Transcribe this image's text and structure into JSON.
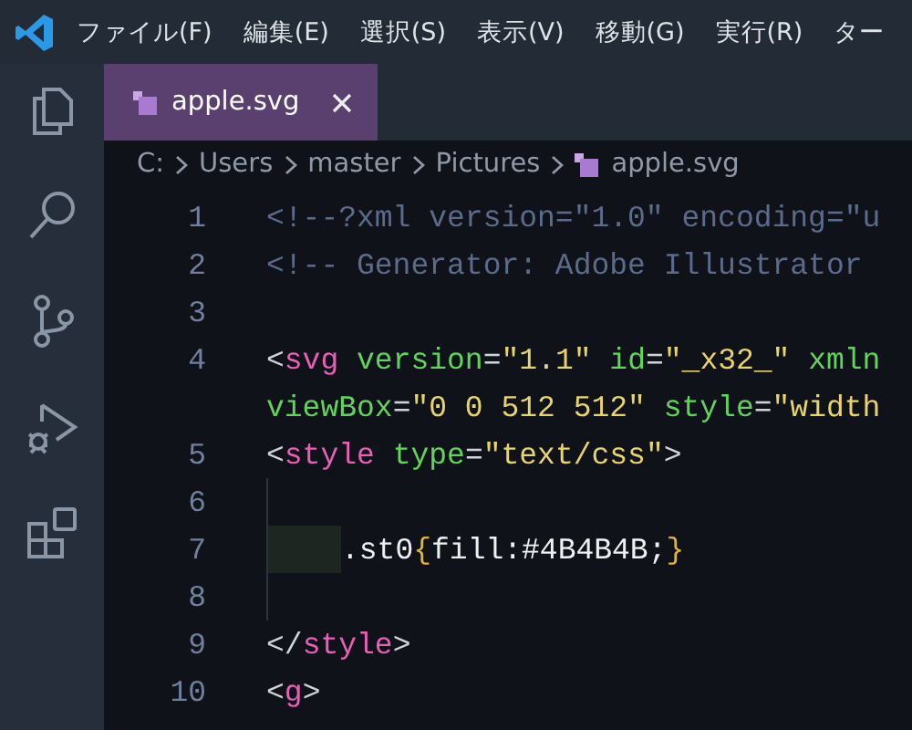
{
  "menu_bar": {
    "items": [
      "ファイル(F)",
      "編集(E)",
      "選択(S)",
      "表示(V)",
      "移動(G)",
      "実行(R)",
      "ター"
    ]
  },
  "activity_bar": {
    "items": [
      {
        "kind": "explorer",
        "selected": false
      },
      {
        "kind": "search",
        "selected": false
      },
      {
        "kind": "source-control",
        "selected": false
      },
      {
        "kind": "run",
        "selected": false
      },
      {
        "kind": "extensions",
        "selected": false
      }
    ]
  },
  "tabs": [
    {
      "label": "apple.svg",
      "selected": true
    }
  ],
  "breadcrumb": [
    {
      "label": "C:",
      "kind": "folder"
    },
    {
      "label": "Users",
      "kind": "folder"
    },
    {
      "label": "master",
      "kind": "folder"
    },
    {
      "label": "Pictures",
      "kind": "folder"
    },
    {
      "label": "apple.svg",
      "kind": "file"
    }
  ],
  "editor": {
    "lines": [
      {
        "number": "1",
        "tokens": [
          {
            "kind": "comment",
            "text": "<!--?xml version=\"1.0\" encoding=\"u"
          }
        ]
      },
      {
        "number": "2",
        "tokens": [
          {
            "kind": "comment",
            "text": "<!-- Generator: Adobe Illustrator"
          }
        ]
      },
      {
        "number": "3"
      },
      {
        "number": "4",
        "tokens": [
          {
            "kind": "punct",
            "text": "<"
          },
          {
            "kind": "tag",
            "text": "svg"
          },
          {
            "kind": "attr",
            "text": " version"
          },
          {
            "kind": "punct",
            "text": "="
          },
          {
            "kind": "string",
            "text": "\"1.1\""
          },
          {
            "kind": "attr",
            "text": " id"
          },
          {
            "kind": "punct",
            "text": "="
          },
          {
            "kind": "string",
            "text": "\"_x32_\""
          },
          {
            "kind": "attr",
            "text": " xmln"
          }
        ]
      },
      {
        "tokens": [
          {
            "kind": "attr",
            "text": "viewBox"
          },
          {
            "kind": "punct",
            "text": "="
          },
          {
            "kind": "string",
            "text": "\"0 0 512 512\""
          },
          {
            "kind": "attr",
            "text": " style"
          },
          {
            "kind": "punct",
            "text": "="
          },
          {
            "kind": "string",
            "text": "\"width"
          }
        ]
      },
      {
        "number": "5",
        "tokens": [
          {
            "kind": "punct",
            "text": "<"
          },
          {
            "kind": "tag",
            "text": "style"
          },
          {
            "kind": "attr",
            "text": " type"
          },
          {
            "kind": "punct",
            "text": "="
          },
          {
            "kind": "string",
            "text": "\"text/css\""
          },
          {
            "kind": "punct",
            "text": ">"
          }
        ]
      },
      {
        "number": "6",
        "indent_guide": true
      },
      {
        "number": "7",
        "indent_guide": true,
        "indent": true,
        "tokens": [
          {
            "kind": "text",
            "text": ".st0"
          },
          {
            "kind": "brace",
            "text": "{"
          },
          {
            "kind": "text",
            "text": "fill:#4B4B4B;"
          },
          {
            "kind": "brace",
            "text": "}"
          }
        ]
      },
      {
        "number": "8",
        "indent_guide": true
      },
      {
        "number": "9",
        "tokens": [
          {
            "kind": "punct",
            "text": "</"
          },
          {
            "kind": "tag",
            "text": "style"
          },
          {
            "kind": "punct",
            "text": ">"
          }
        ]
      },
      {
        "number": "10",
        "tokens": [
          {
            "kind": "punct",
            "text": "<"
          },
          {
            "kind": "tag",
            "text": "g"
          },
          {
            "kind": "punct",
            "text": ">"
          }
        ]
      }
    ]
  }
}
